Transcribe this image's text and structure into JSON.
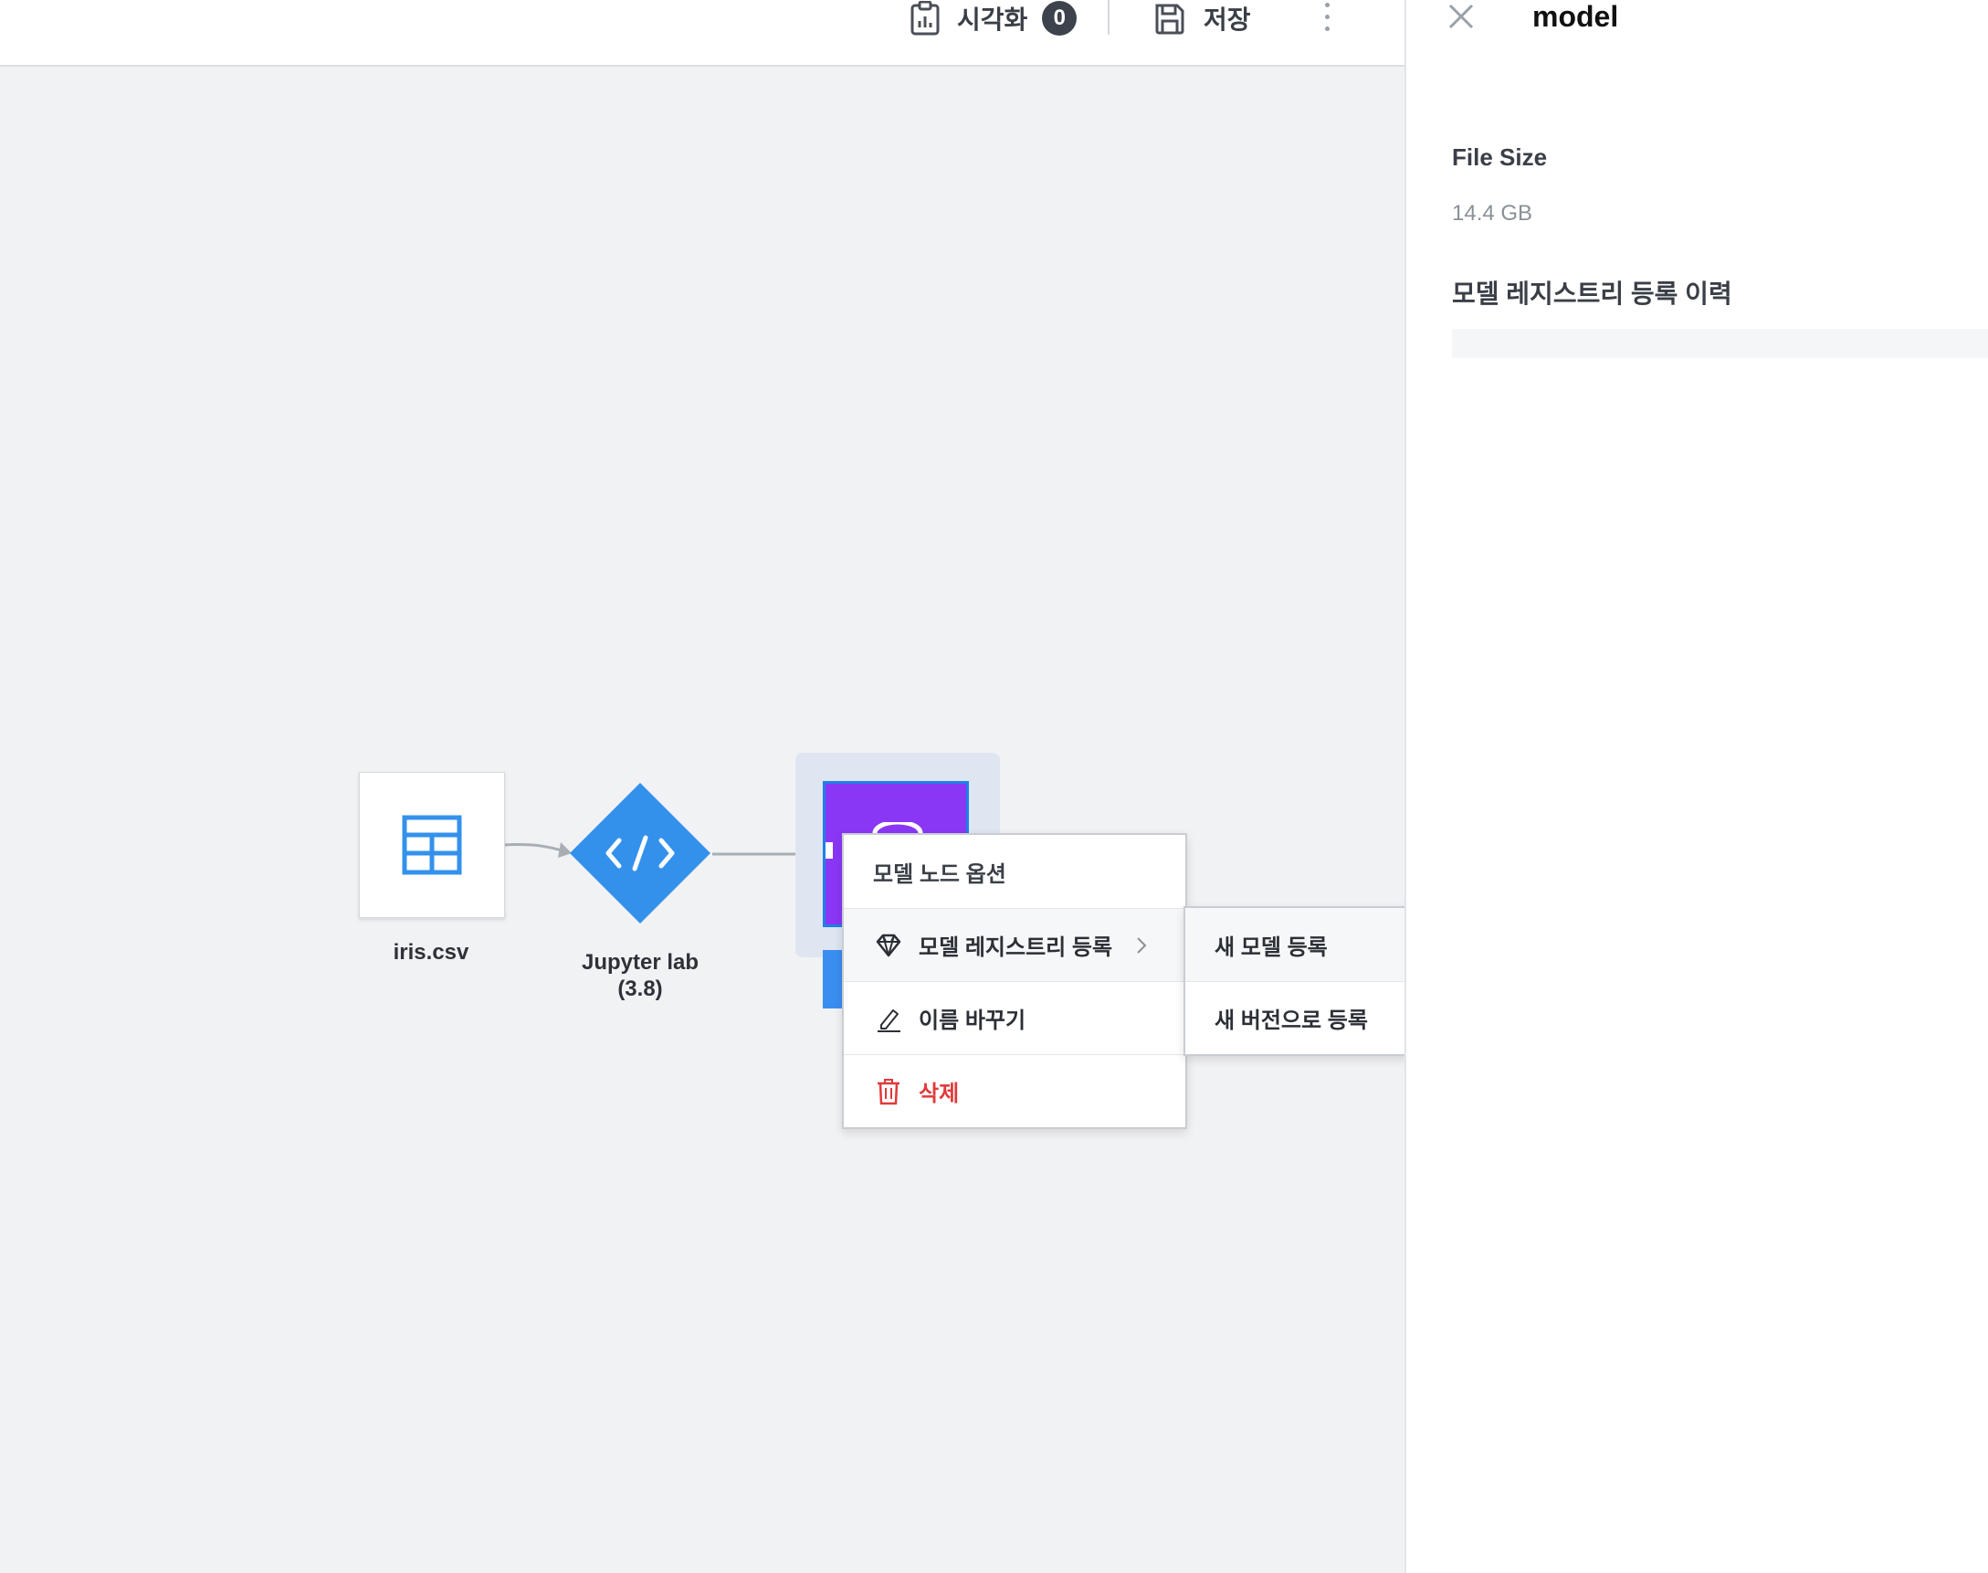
{
  "toolbar": {
    "visualize_label": "시각화",
    "visualize_count": "0",
    "save_label": "저장"
  },
  "canvas": {
    "nodes": [
      {
        "label": "iris.csv",
        "icon": "table-icon"
      },
      {
        "label": "Jupyter lab",
        "sublabel": "(3.8)",
        "icon": "code-icon"
      },
      {
        "label": "",
        "icon": "model-icon"
      }
    ]
  },
  "context_menu": {
    "title": "모델 노드 옵션",
    "items": [
      {
        "label": "모델 레지스트리 등록",
        "icon": "gem-icon",
        "has_submenu": true
      },
      {
        "label": "이름 바꾸기",
        "icon": "pencil-icon"
      },
      {
        "label": "삭제",
        "icon": "trash-icon",
        "danger": true
      }
    ],
    "submenu": [
      "새 모델 등록",
      "새 버전으로 등록"
    ]
  },
  "panel": {
    "title": "model",
    "file_size_label": "File Size",
    "file_size_value": "14.4 GB",
    "history_label": "모델 레지스트리 등록 이력"
  },
  "colors": {
    "accent_blue": "#3391ec",
    "model_purple": "#8a37f5",
    "danger_red": "#e0393b",
    "canvas_bg": "#f1f2f4"
  }
}
